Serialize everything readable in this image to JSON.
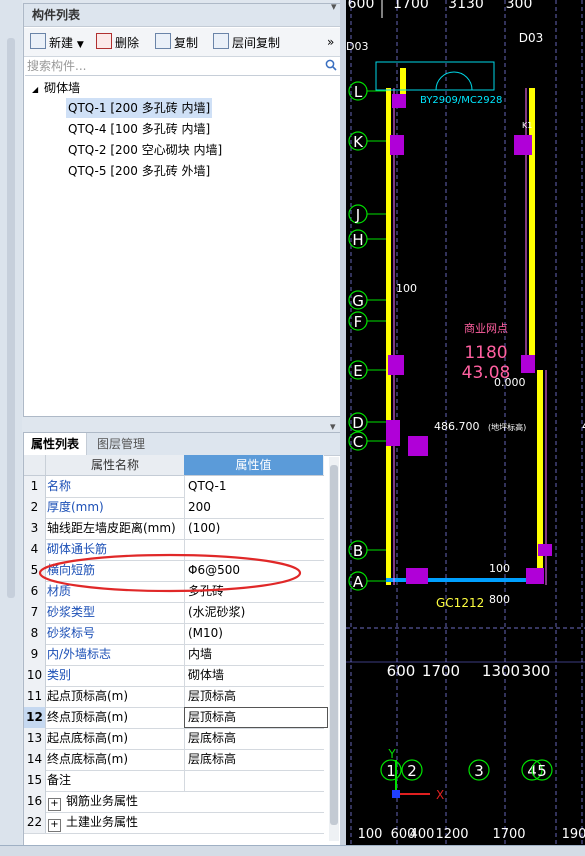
{
  "component_panel": {
    "title": "构件列表",
    "toolbar": {
      "new": "新建",
      "delete": "删除",
      "copy": "复制",
      "floor_copy": "层间复制"
    },
    "search_placeholder": "搜索构件...",
    "tree": {
      "root": "砌体墙",
      "items": [
        {
          "label": "QTQ-1 [200 多孔砖 内墙]",
          "selected": true
        },
        {
          "label": "QTQ-4 [100 多孔砖 内墙]",
          "selected": false
        },
        {
          "label": "QTQ-2 [200 空心砌块 内墙]",
          "selected": false
        },
        {
          "label": "QTQ-5 [200 多孔砖 外墙]",
          "selected": false
        }
      ]
    }
  },
  "property_panel": {
    "tabs": [
      "属性列表",
      "图层管理"
    ],
    "headers": {
      "name": "属性名称",
      "value": "属性值"
    },
    "rows": [
      {
        "num": "1",
        "name": "名称",
        "value": "QTQ-1",
        "blue": true
      },
      {
        "num": "2",
        "name": "厚度(mm)",
        "value": "200",
        "blue": true
      },
      {
        "num": "3",
        "name": "轴线距左墙皮距离(mm)",
        "value": "(100)",
        "blue": false
      },
      {
        "num": "4",
        "name": "砌体通长筋",
        "value": "",
        "blue": true
      },
      {
        "num": "5",
        "name": "横向短筋",
        "value": "Φ6@500",
        "blue": true
      },
      {
        "num": "6",
        "name": "材质",
        "value": "多孔砖",
        "blue": true
      },
      {
        "num": "7",
        "name": "砂浆类型",
        "value": "(水泥砂浆)",
        "blue": true
      },
      {
        "num": "8",
        "name": "砂浆标号",
        "value": "(M10)",
        "blue": true
      },
      {
        "num": "9",
        "name": "内/外墙标志",
        "value": "内墙",
        "blue": true
      },
      {
        "num": "10",
        "name": "类别",
        "value": "砌体墙",
        "blue": true
      },
      {
        "num": "11",
        "name": "起点顶标高(m)",
        "value": "层顶标高",
        "blue": false
      },
      {
        "num": "12",
        "name": "终点顶标高(m)",
        "value": "层顶标高",
        "blue": false
      },
      {
        "num": "13",
        "name": "起点底标高(m)",
        "value": "层底标高",
        "blue": false
      },
      {
        "num": "14",
        "name": "终点底标高(m)",
        "value": "层底标高",
        "blue": false
      },
      {
        "num": "15",
        "name": "备注",
        "value": "",
        "blue": false
      },
      {
        "num": "16",
        "name": "钢筋业务属性",
        "value": "",
        "blue": false,
        "group": true
      },
      {
        "num": "22",
        "name": "土建业务属性",
        "value": "",
        "blue": false,
        "group": true
      }
    ]
  },
  "cad": {
    "axes_left": [
      "L",
      "K",
      "J",
      "H",
      "G",
      "F",
      "E",
      "D",
      "C",
      "B",
      "A"
    ],
    "axes_bottom": [
      "1",
      "2",
      "3",
      "4",
      "5"
    ],
    "top_dims": [
      "600",
      "1700",
      "3130",
      "300"
    ],
    "bottom_dims": [
      "600",
      "1700",
      "1300",
      "300"
    ],
    "bottom_dims2": [
      "100",
      "600",
      "400",
      "1200",
      "1700",
      "190"
    ],
    "labels": {
      "d03": "D03",
      "d03b": "D03",
      "door": "BY2909/MC2928",
      "k1": "K1",
      "dim100": "100",
      "room_name": "商业网点",
      "room_area": "1180",
      "room_h": "43.08",
      "elev0": "0.000",
      "elev1": "486.700",
      "elev1_note": "(地坪标高)",
      "gc": "GC1212",
      "dim100b": "100",
      "dim800": "800",
      "edge_num": "4",
      "axis_x": "X",
      "axis_y": "Y"
    }
  },
  "colors": {
    "wall": "#ffff00",
    "column": "#b000d8",
    "axis": "#00e000",
    "selection_ring": "#e02828",
    "grid": "#8f8fff"
  }
}
